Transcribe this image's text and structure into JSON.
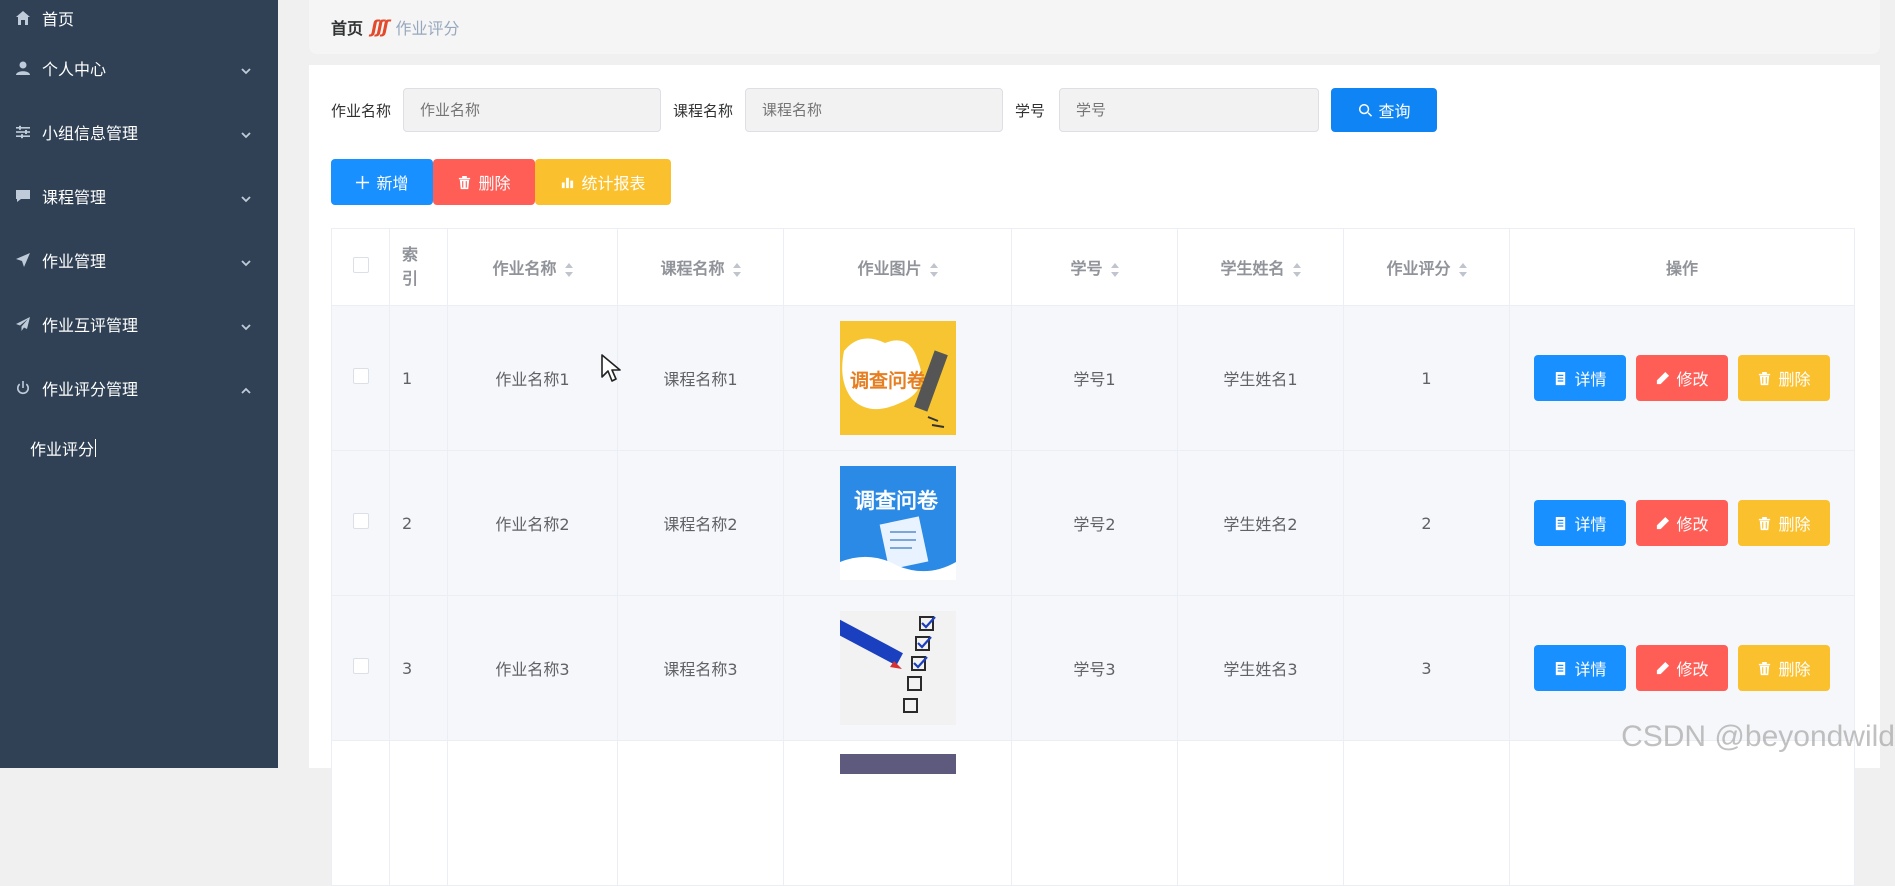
{
  "sidebar": {
    "items": [
      {
        "label": "首页",
        "icon": "home-icon",
        "chevron": ""
      },
      {
        "label": "个人中心",
        "icon": "user-icon",
        "chevron": "down"
      },
      {
        "label": "小组信息管理",
        "icon": "sliders-icon",
        "chevron": "down"
      },
      {
        "label": "课程管理",
        "icon": "chat-icon",
        "chevron": "down"
      },
      {
        "label": "作业管理",
        "icon": "send-icon",
        "chevron": "down"
      },
      {
        "label": "作业互评管理",
        "icon": "paper-plane-icon",
        "chevron": "down"
      },
      {
        "label": "作业评分管理",
        "icon": "power-icon",
        "chevron": "up"
      }
    ],
    "submenu": {
      "label": "作业评分"
    }
  },
  "breadcrumb": {
    "home": "首页",
    "separator": "ʃʃʃ",
    "current": "作业评分"
  },
  "search": {
    "homework_label": "作业名称",
    "homework_placeholder": "作业名称",
    "course_label": "课程名称",
    "course_placeholder": "课程名称",
    "student_label": "学号",
    "student_placeholder": "学号",
    "button": "查询"
  },
  "actions": {
    "add": "新增",
    "delete": "删除",
    "report": "统计报表"
  },
  "table": {
    "headers": {
      "index": "索引",
      "homework_name": "作业名称",
      "course_name": "课程名称",
      "image": "作业图片",
      "student_no": "学号",
      "student_name": "学生姓名",
      "score": "作业评分",
      "ops": "操作"
    },
    "rows": [
      {
        "index": "1",
        "homework_name": "作业名称1",
        "course_name": "课程名称1",
        "image_text": "调查问卷",
        "student_no": "学号1",
        "student_name": "学生姓名1",
        "score": "1"
      },
      {
        "index": "2",
        "homework_name": "作业名称2",
        "course_name": "课程名称2",
        "image_text": "调查问卷",
        "student_no": "学号2",
        "student_name": "学生姓名2",
        "score": "2"
      },
      {
        "index": "3",
        "homework_name": "作业名称3",
        "course_name": "课程名称3",
        "image_text": "",
        "student_no": "学号3",
        "student_name": "学生姓名3",
        "score": "3"
      }
    ],
    "row_actions": {
      "detail": "详情",
      "edit": "修改",
      "delete": "删除"
    }
  },
  "watermark": "CSDN @beyondwild",
  "colors": {
    "sidebar": "#304156",
    "primary": "#1890ff",
    "danger": "#ff5e57",
    "warning": "#fbc02d"
  }
}
